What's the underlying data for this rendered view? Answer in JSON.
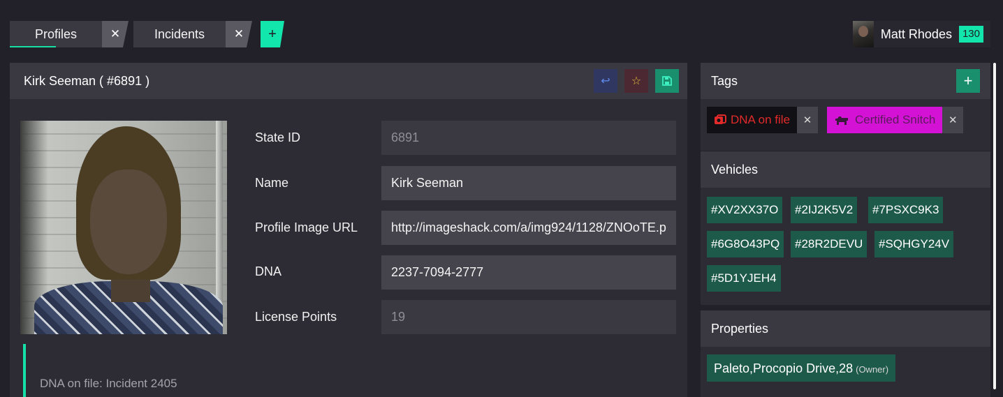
{
  "tabs": [
    {
      "label": "Profiles",
      "active": true,
      "close": "✕"
    },
    {
      "label": "Incidents",
      "active": false,
      "close": "✕"
    }
  ],
  "add_tab_label": "+",
  "user": {
    "name": "Matt Rhodes",
    "badge": "130"
  },
  "profile": {
    "title": "Kirk Seeman ( #6891 )",
    "fields": {
      "state_id": {
        "label": "State ID",
        "value": "6891"
      },
      "name": {
        "label": "Name",
        "value": "Kirk Seeman"
      },
      "image_url": {
        "label": "Profile Image URL",
        "value": "http://imageshack.com/a/img924/1128/ZNOoTE.p"
      },
      "dna": {
        "label": "DNA",
        "value": "2237-7094-2777"
      },
      "license_points": {
        "label": "License Points",
        "value": "19"
      }
    },
    "note": "DNA on file: Incident 2405"
  },
  "tags": {
    "title": "Tags",
    "add_label": "+",
    "items": [
      {
        "label": "DNA on file",
        "color": "#e22a2a",
        "icon": "dna-icon"
      },
      {
        "label": "Certified Snitch",
        "color": "#d312d6",
        "icon": "dog-icon"
      }
    ]
  },
  "vehicles": {
    "title": "Vehicles",
    "plates": [
      "#XV2XX37O",
      "#2IJ2K5V2",
      "#7PSXC9K3",
      "#6G8O43PQ",
      "#28R2DEVU",
      "#SQHGY24V",
      "#5D1YJEH4"
    ]
  },
  "properties": {
    "title": "Properties",
    "items": [
      {
        "address": "Paleto,Procopio Drive,28",
        "role": "(Owner)"
      }
    ]
  },
  "colors": {
    "accent": "#14e0a8",
    "panel": "#2d2c34",
    "header": "#3a3942"
  }
}
